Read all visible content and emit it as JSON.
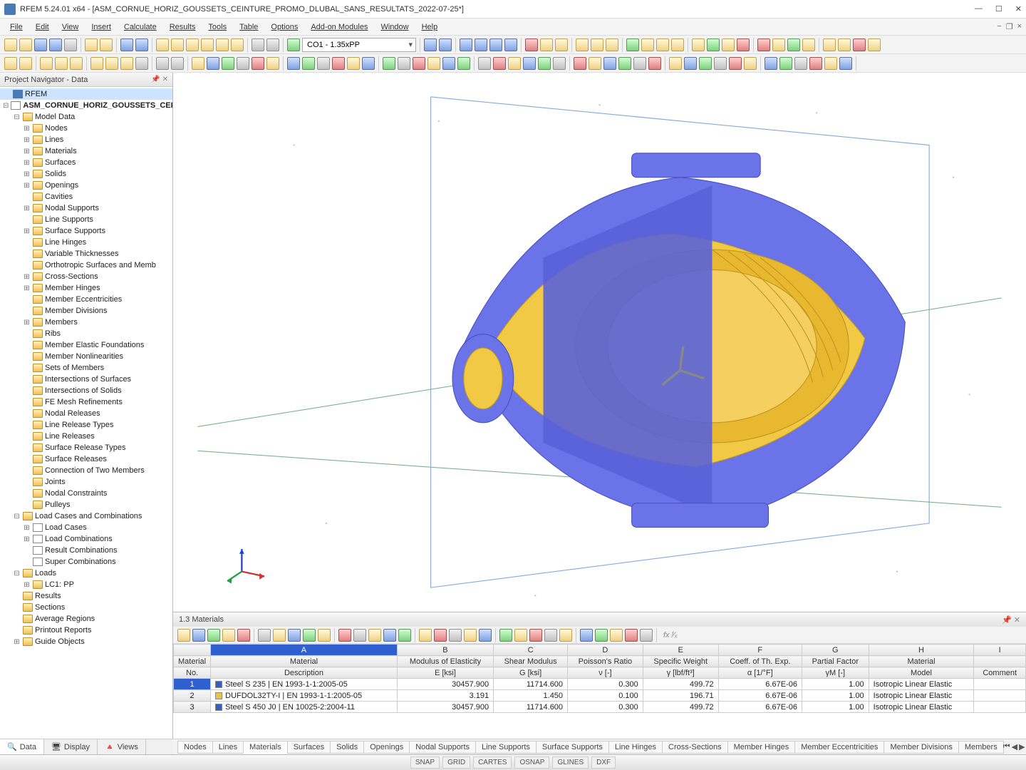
{
  "window": {
    "title": "RFEM 5.24.01 x64 - [ASM_CORNUE_HORIZ_GOUSSETS_CEINTURE_PROMO_DLUBAL_SANS_RESULTATS_2022-07-25*]"
  },
  "menu": [
    "File",
    "Edit",
    "View",
    "Insert",
    "Calculate",
    "Results",
    "Tools",
    "Table",
    "Options",
    "Add-on Modules",
    "Window",
    "Help"
  ],
  "combo_load": "CO1 - 1.35xPP",
  "navigator": {
    "title": "Project Navigator - Data",
    "root": "RFEM",
    "model": "ASM_CORNUE_HORIZ_GOUSSETS_CEI",
    "group_model_data": "Model Data",
    "items_model_data": [
      "Nodes",
      "Lines",
      "Materials",
      "Surfaces",
      "Solids",
      "Openings",
      "Cavities",
      "Nodal Supports",
      "Line Supports",
      "Surface Supports",
      "Line Hinges",
      "Variable Thicknesses",
      "Orthotropic Surfaces and Memb",
      "Cross-Sections",
      "Member Hinges",
      "Member Eccentricities",
      "Member Divisions",
      "Members",
      "Ribs",
      "Member Elastic Foundations",
      "Member Nonlinearities",
      "Sets of Members",
      "Intersections of Surfaces",
      "Intersections of Solids",
      "FE Mesh Refinements",
      "Nodal Releases",
      "Line Release Types",
      "Line Releases",
      "Surface Release Types",
      "Surface Releases",
      "Connection of Two Members",
      "Joints",
      "Nodal Constraints",
      "Pulleys"
    ],
    "group_load_cases": "Load Cases and Combinations",
    "items_load_cases": [
      "Load Cases",
      "Load Combinations",
      "Result Combinations",
      "Super Combinations"
    ],
    "group_loads": "Loads",
    "items_loads": [
      "LC1: PP"
    ],
    "items_after": [
      "Results",
      "Sections",
      "Average Regions",
      "Printout Reports",
      "Guide Objects"
    ],
    "tabs": [
      "Data",
      "Display",
      "Views"
    ]
  },
  "table": {
    "title": "1.3 Materials",
    "col_letters": [
      "A",
      "B",
      "C",
      "D",
      "E",
      "F",
      "G",
      "H",
      "I"
    ],
    "header_row1": {
      "no": "Material",
      "a": "Material",
      "b": "Modulus of Elasticity",
      "c": "Shear Modulus",
      "d": "Poisson's Ratio",
      "e": "Specific Weight",
      "f": "Coeff. of Th. Exp.",
      "g": "Partial Factor",
      "h": "Material",
      "i": ""
    },
    "header_row2": {
      "no": "No.",
      "a": "Description",
      "b": "E [ksi]",
      "c": "G [ksi]",
      "d": "ν [-]",
      "e": "γ [lbf/ft³]",
      "f": "α [1/°F]",
      "g": "γM [-]",
      "h": "Model",
      "i": "Comment"
    },
    "rows": [
      {
        "no": "1",
        "color": "#3a5fb8",
        "desc": "Steel S 235 | EN 1993-1-1:2005-05",
        "e": "30457.900",
        "g": "11714.600",
        "nu": "0.300",
        "w": "499.72",
        "a": "6.67E-06",
        "pf": "1.00",
        "model": "Isotropic Linear Elastic",
        "comment": ""
      },
      {
        "no": "2",
        "color": "#f0c050",
        "desc": "DUFDOL32TY-I | EN 1993-1-1:2005-05",
        "e": "3.191",
        "g": "1.450",
        "nu": "0.100",
        "w": "196.71",
        "a": "6.67E-06",
        "pf": "1.00",
        "model": "Isotropic Linear Elastic",
        "comment": ""
      },
      {
        "no": "3",
        "color": "#3a5fb8",
        "desc": "Steel S 450 J0 | EN 10025-2:2004-11",
        "e": "30457.900",
        "g": "11714.600",
        "nu": "0.300",
        "w": "499.72",
        "a": "6.67E-06",
        "pf": "1.00",
        "model": "Isotropic Linear Elastic",
        "comment": ""
      }
    ]
  },
  "bottom_tabs": [
    "Nodes",
    "Lines",
    "Materials",
    "Surfaces",
    "Solids",
    "Openings",
    "Nodal Supports",
    "Line Supports",
    "Surface Supports",
    "Line Hinges",
    "Cross-Sections",
    "Member Hinges",
    "Member Eccentricities",
    "Member Divisions",
    "Members"
  ],
  "bottom_active": "Materials",
  "status": [
    "SNAP",
    "GRID",
    "CARTES",
    "OSNAP",
    "GLINES",
    "DXF"
  ]
}
